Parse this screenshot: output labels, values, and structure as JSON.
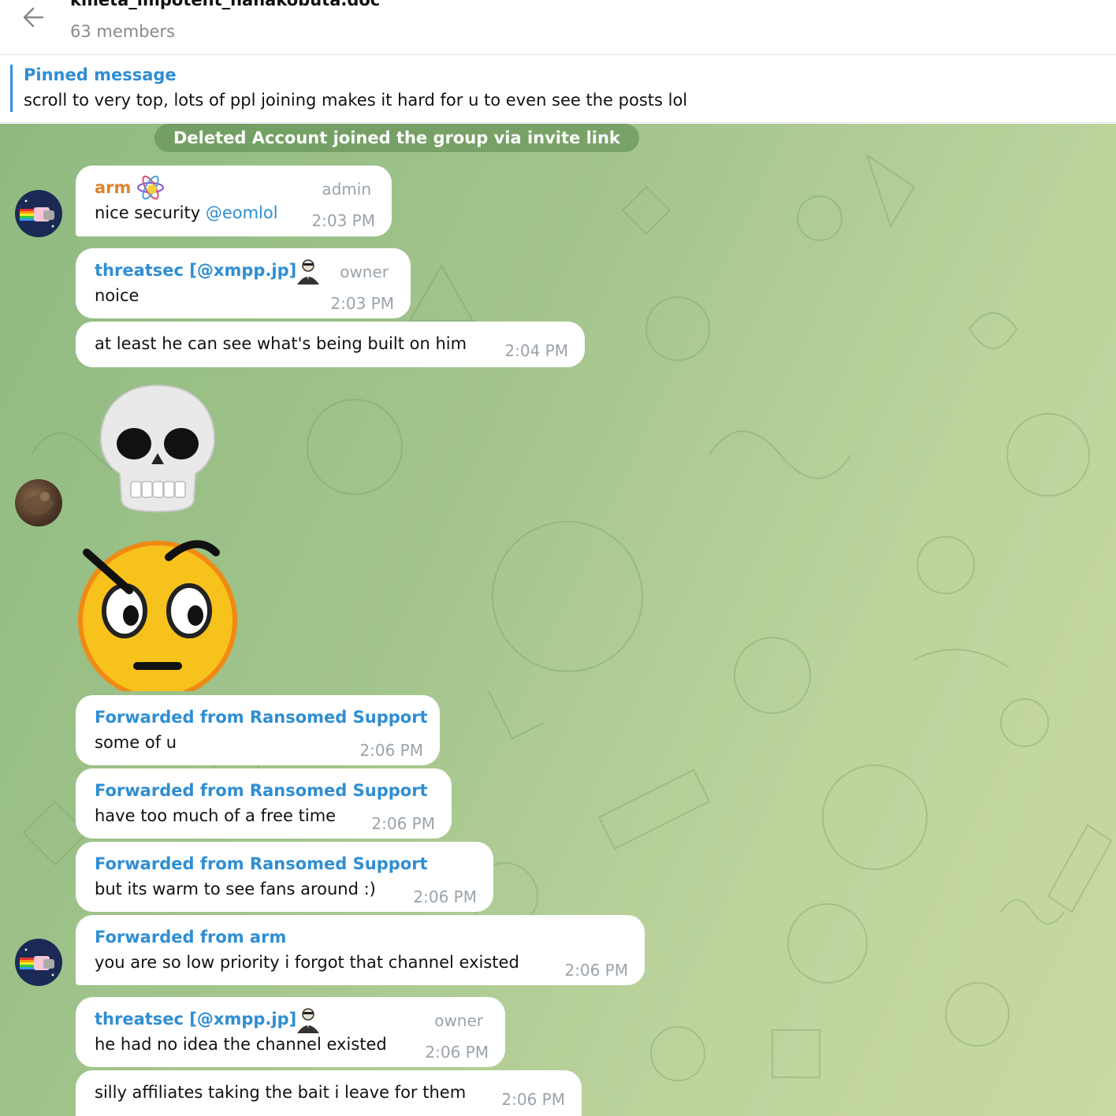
{
  "header": {
    "title": "kmeta_impotent_hanakobuta.doc",
    "subtitle": "63 members"
  },
  "pinned": {
    "title": "Pinned message",
    "text": "scroll to very top, lots of ppl joining makes it hard for u to even see the posts lol"
  },
  "service": "Deleted Account joined the group via invite link",
  "messages": [
    {
      "sender": "arm",
      "role": "admin",
      "text": "nice security ",
      "mention": "@eomlol",
      "time": "2:03 PM"
    },
    {
      "sender": "threatsec [@xmpp.jp]",
      "role": "owner",
      "text": "noice",
      "time": "2:03 PM"
    },
    {
      "text": "at least he can see what's being built on him",
      "time": "2:04 PM"
    },
    {
      "forward": "Forwarded from Ransomed Support",
      "text": "some of u",
      "time": "2:06 PM"
    },
    {
      "forward": "Forwarded from Ransomed Support",
      "text": "have too much of a free time",
      "time": "2:06 PM"
    },
    {
      "forward": "Forwarded from Ransomed Support",
      "text": "but its warm to see fans around :)",
      "time": "2:06 PM"
    },
    {
      "forward": "Forwarded from arm",
      "text": "you are so low priority i forgot that channel existed",
      "time": "2:06 PM"
    },
    {
      "sender": "threatsec [@xmpp.jp]",
      "role": "owner",
      "text": "he had no idea the channel existed",
      "time": "2:06 PM"
    },
    {
      "text": "silly affiliates taking the bait i leave for them",
      "time": "2:06 PM"
    }
  ],
  "stickers": [
    "skull-emoji",
    "raised-eyebrow-emoji"
  ],
  "colors": {
    "accent": "#2f8ed3",
    "admin_name": "#e0822c",
    "time": "#9aa3ab",
    "chat_bg": "#a3c58c"
  }
}
